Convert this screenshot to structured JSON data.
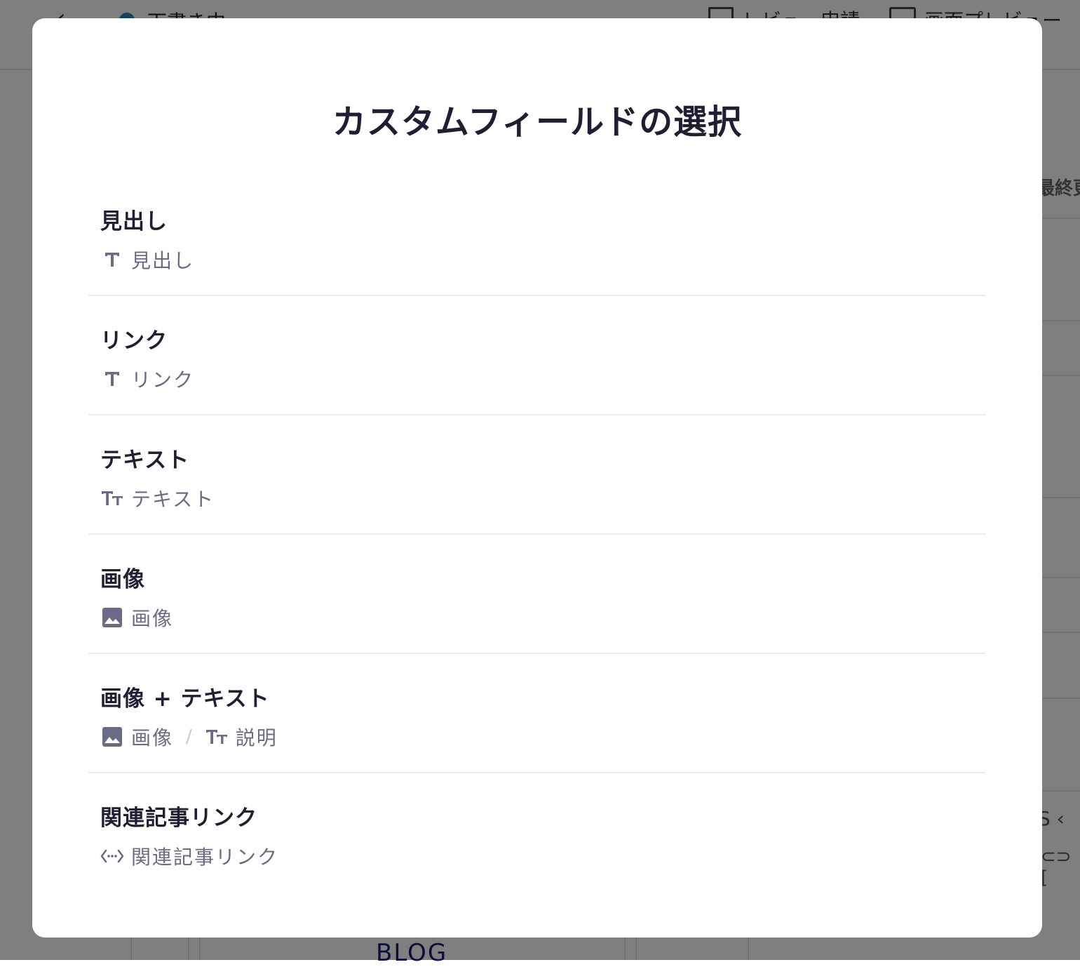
{
  "background": {
    "status_label": "下書き中",
    "review_label": "レビュー申請",
    "preview_label": "画面プレビュー",
    "right_label": "最終更",
    "bottom_label": "BLOG"
  },
  "modal": {
    "title": "カスタムフィールドの選択",
    "fields": [
      {
        "name": "見出し",
        "parts": [
          {
            "icon": "text-icon",
            "label": "見出し"
          }
        ]
      },
      {
        "name": "リンク",
        "parts": [
          {
            "icon": "text-icon",
            "label": "リンク"
          }
        ]
      },
      {
        "name": "テキスト",
        "parts": [
          {
            "icon": "rich-text-icon",
            "label": "テキスト"
          }
        ]
      },
      {
        "name": "画像",
        "parts": [
          {
            "icon": "image-icon",
            "label": "画像"
          }
        ]
      },
      {
        "name": "画像 + テキスト",
        "parts": [
          {
            "icon": "image-icon",
            "label": "画像"
          },
          {
            "icon": "rich-text-icon",
            "label": "説明"
          }
        ],
        "separator": "/"
      },
      {
        "name": "関連記事リンク",
        "parts": [
          {
            "icon": "relation-icon",
            "label": "関連記事リンク"
          }
        ]
      }
    ]
  }
}
